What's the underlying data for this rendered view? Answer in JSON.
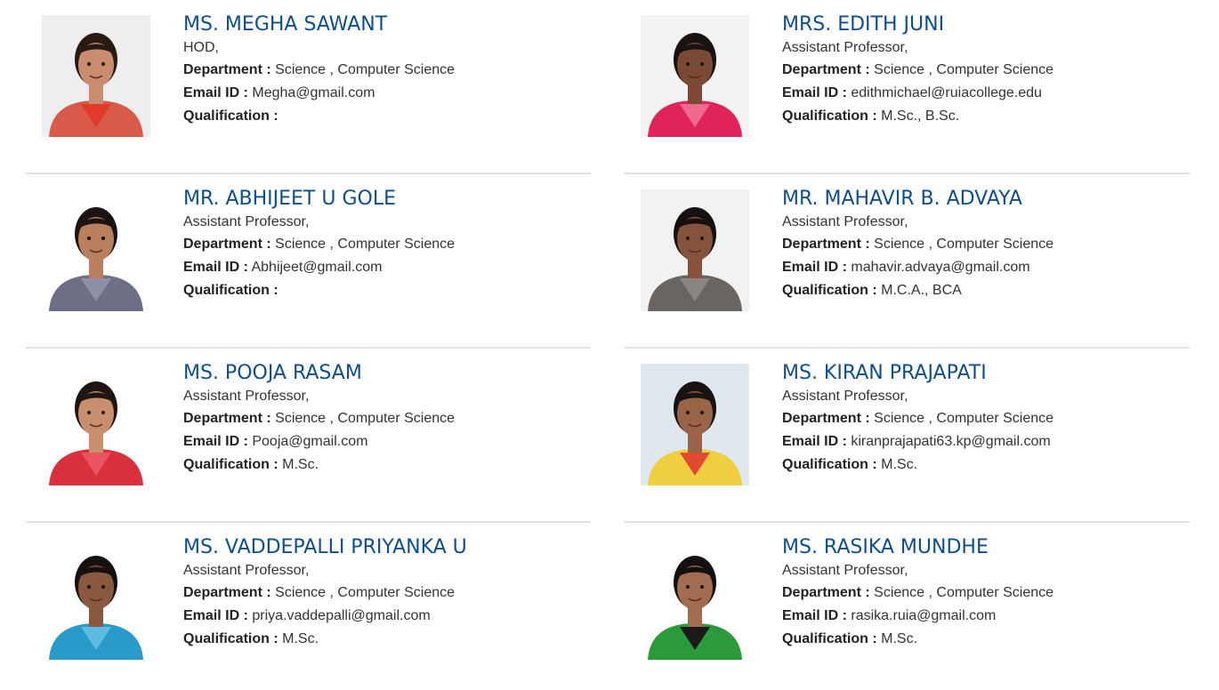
{
  "labels": {
    "department": "Department :",
    "email": "Email ID :",
    "qualification": "Qualification :"
  },
  "faculty": [
    {
      "name": "MS. MEGHA SAWANT",
      "role": "HOD,",
      "department": "Science , Computer Science",
      "email": "Megha@gmail.com",
      "qualification": "",
      "photo": {
        "bg": "#eeeeee",
        "skin": "#c98c6e",
        "hair": "#2a1a14",
        "shirt": "#d85a4a",
        "accent": "#e23a2a"
      }
    },
    {
      "name": "MRS. EDITH JUNI",
      "role": "Assistant Professor,",
      "department": "Science , Computer Science",
      "email": "edithmichael@ruiacollege.edu",
      "qualification": "M.Sc., B.Sc.",
      "photo": {
        "bg": "#f3f3f3",
        "skin": "#7a4a35",
        "hair": "#1a1210",
        "shirt": "#e0245a",
        "accent": "#f06a90"
      }
    },
    {
      "name": "MR. ABHIJEET U GOLE",
      "role": "Assistant Professor,",
      "department": "Science , Computer Science",
      "email": "Abhijeet@gmail.com",
      "qualification": "",
      "photo": {
        "bg": "#ffffff",
        "skin": "#b9805f",
        "hair": "#1b1412",
        "shirt": "#6c6f86",
        "accent": "#8d90a6"
      }
    },
    {
      "name": "MR. MAHAVIR B. ADVAYA",
      "role": "Assistant Professor,",
      "department": "Science , Computer Science",
      "email": "mahavir.advaya@gmail.com",
      "qualification": "M.C.A., BCA",
      "photo": {
        "bg": "#f2f2f2",
        "skin": "#86543c",
        "hair": "#161010",
        "shirt": "#6a6560",
        "accent": "#8a8580"
      }
    },
    {
      "name": "MS. POOJA RASAM",
      "role": "Assistant Professor,",
      "department": "Science , Computer Science",
      "email": "Pooja@gmail.com",
      "qualification": "M.Sc.",
      "photo": {
        "bg": "#ffffff",
        "skin": "#c78f6e",
        "hair": "#1f1612",
        "shirt": "#d8303c",
        "accent": "#e85560"
      }
    },
    {
      "name": "MS. KIRAN PRAJAPATI",
      "role": "Assistant Professor,",
      "department": "Science , Computer Science",
      "email": "kiranprajapati63.kp@gmail.com",
      "qualification": "M.Sc.",
      "photo": {
        "bg": "#dfe8ee",
        "skin": "#9a6448",
        "hair": "#181210",
        "shirt": "#f0d040",
        "accent": "#e04a30"
      }
    },
    {
      "name": "MS. VADDEPALLI PRIYANKA U",
      "role": "Assistant Professor,",
      "department": "Science , Computer Science",
      "email": "priya.vaddepalli@gmail.com",
      "qualification": "M.Sc.",
      "photo": {
        "bg": "#ffffff",
        "skin": "#8a5a40",
        "hair": "#161010",
        "shirt": "#2a9ac8",
        "accent": "#5cbbe0"
      }
    },
    {
      "name": "MS. RASIKA MUNDHE",
      "role": "Assistant Professor,",
      "department": "Science , Computer Science",
      "email": "rasika.ruia@gmail.com",
      "qualification": "M.Sc.",
      "photo": {
        "bg": "#ffffff",
        "skin": "#a26c50",
        "hair": "#141010",
        "shirt": "#2a9a3a",
        "accent": "#1a1a1a"
      }
    }
  ]
}
